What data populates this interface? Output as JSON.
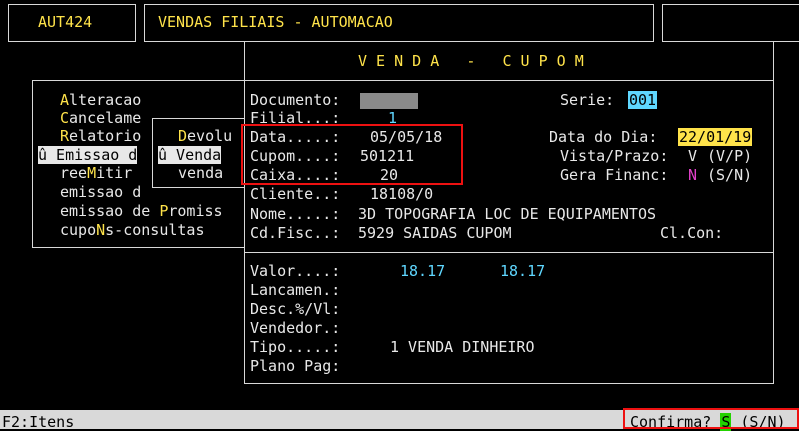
{
  "header": {
    "app_code": "AUT424",
    "title": "VENDAS FILIAIS - AUTOMACAO"
  },
  "menu": {
    "items": [
      {
        "hot": "A",
        "rest": "lteracao"
      },
      {
        "hot": "",
        "rest": "Cancelame"
      },
      {
        "hot": "R",
        "rest": "elatorio"
      },
      {
        "hot": "",
        "rest": "û Emissao d"
      },
      {
        "hot": "",
        "rest": "reeMitir"
      },
      {
        "hot": "",
        "rest": "emissao d"
      },
      {
        "hot": "",
        "rest": "emissao de Promiss"
      },
      {
        "hot": "",
        "rest": "cupoNs-consultas"
      }
    ],
    "submenu": [
      "Devolu",
      "û Venda",
      "venda"
    ]
  },
  "dialog": {
    "title": "V E N D A   -   C U P O M",
    "documento_label": "Documento:",
    "serie_label": "Serie:",
    "serie_value": "001",
    "filial_label": "Filial...:",
    "filial_value": "1",
    "data_label": "Data.....:",
    "data_value": "05/05/18",
    "data_dia_label": "Data do Dia:",
    "data_dia_value": "22/01/19",
    "cupom_label": "Cupom....:",
    "cupom_value": "501211",
    "vista_label": "Vista/Prazo:",
    "vista_value": "V",
    "vista_hint": "(V/P)",
    "caixa_label": "Caixa....:",
    "caixa_value": "20",
    "gera_label": "Gera Financ:",
    "gera_value": "N",
    "gera_hint": "(S/N)",
    "cliente_label": "Cliente..:",
    "cliente_value": "18108/0",
    "nome_label": "Nome.....:",
    "nome_value": "3D TOPOGRAFIA LOC DE EQUIPAMENTOS",
    "cdfisc_label": "Cd.Fisc..:",
    "cdfisc_value": "5929 SAIDAS CUPOM",
    "clcon_label": "Cl.Con:",
    "valor_label": "Valor....:",
    "valor_1": "18.17",
    "valor_2": "18.17",
    "lancamen_label": "Lancamen.:",
    "desc_label": "Desc.%/Vl:",
    "vendedor_label": "Vendedor.:",
    "tipo_label": "Tipo.....:",
    "tipo_value": "1 VENDA DINHEIRO",
    "plano_label": "Plano Pag:"
  },
  "status_bar": {
    "left": "F2:Itens",
    "confirm_label": "Confirma?",
    "confirm_value": "S",
    "confirm_hint": "(S/N)"
  }
}
